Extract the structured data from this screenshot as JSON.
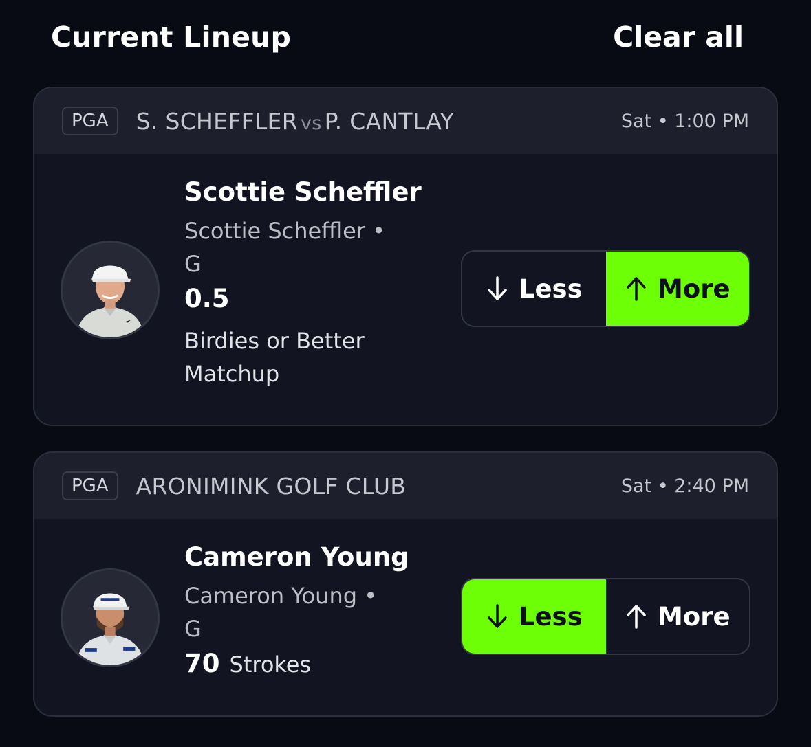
{
  "header": {
    "title": "Current Lineup",
    "clear_all": "Clear all"
  },
  "picks": [
    {
      "league": "PGA",
      "matchup_left": "S. SCHEFFLER",
      "matchup_vs": "vs",
      "matchup_right": "P. CANTLAY",
      "time": "Sat • 1:00 PM",
      "player_name": "Scottie Scheffler",
      "team_line": "Scottie Scheffler • G",
      "line_value": "0.5",
      "stat": "Birdies or Better Matchup",
      "selected": "More",
      "less_label": "Less",
      "more_label": "More"
    },
    {
      "league": "PGA",
      "event": "ARONIMINK GOLF CLUB",
      "time": "Sat • 2:40 PM",
      "player_name": "Cameron Young",
      "team_line": "Cameron Young • G",
      "line_value": "70",
      "stat": "Strokes",
      "selected": "Less",
      "less_label": "Less",
      "more_label": "More"
    }
  ],
  "colors": {
    "background": "#080a14",
    "card": "#121521",
    "card_header": "#1d202c",
    "accent_selected": "#6dff05"
  },
  "icons": {
    "less": "arrow-down-icon",
    "more": "arrow-up-icon"
  }
}
